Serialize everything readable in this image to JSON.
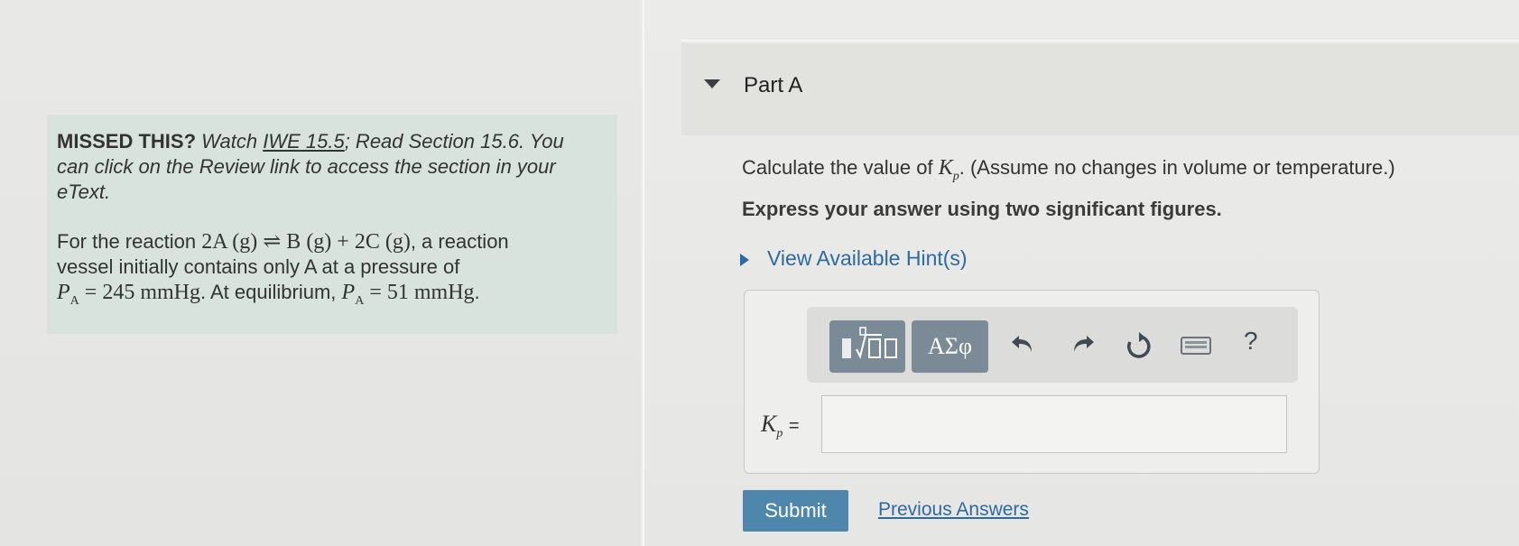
{
  "part": {
    "title": "Part A"
  },
  "info": {
    "missed_label": "MISSED THIS?",
    "watch_text": "Watch",
    "iwe_link": "IWE 15.5",
    "read_text": "; Read Section 15.6. You",
    "line2": "can click on the Review link to access the section in your",
    "line3": "eText.",
    "reaction_prefix": "For the reaction",
    "reaction_suffix": ", a reaction",
    "vessel_line": "vessel initially contains only A at a pressure of",
    "eq_mid": ". At equilibrium,",
    "eq_end": "."
  },
  "question": {
    "calc_prefix": "Calculate the value of",
    "calc_suffix": ". (Assume no changes in volume or temperature.)",
    "express": "Express your answer using two significant figures.",
    "hint_label": "View Available Hint(s)"
  },
  "toolbar": {
    "greek_label": "ΑΣφ",
    "help_label": "?"
  },
  "answer": {
    "value": "",
    "placeholder": ""
  },
  "actions": {
    "submit_label": "Submit",
    "previous_label": "Previous Answers"
  },
  "colors": {
    "accent": "#2c6aa0",
    "button": "#4f86ab",
    "info_bg": "#d8e3dd",
    "toolbar_btn": "#7a8a97"
  },
  "icons": [
    "chevron-down-icon",
    "chevron-right-icon",
    "templates-icon",
    "undo-icon",
    "redo-icon",
    "reset-icon",
    "keyboard-icon",
    "help-icon"
  ]
}
